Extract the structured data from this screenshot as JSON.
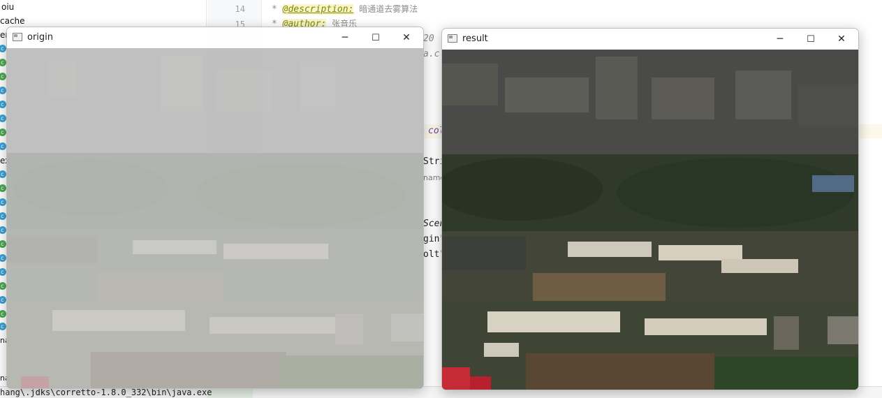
{
  "project_tree": {
    "items": [
      {
        "label": "oiu"
      },
      {
        "label": "cache"
      },
      {
        "label": "en"
      },
      {
        "label": "ex"
      }
    ]
  },
  "editor": {
    "line_numbers": [
      "14",
      "15"
    ],
    "comment_line_1": {
      "tag": "@description:",
      "text": "暗通道去雾算法"
    },
    "comment_line_2": {
      "tag": "@author:",
      "text": "张音乐"
    },
    "fragments": {
      "date_hint": "20",
      "url_hint": "a.c",
      "col_hint": "col",
      "stri": "Stri",
      "name_hint": "name",
      "scen": "Scen",
      "gin": "gin\"",
      "olt": "olt\""
    }
  },
  "console": {
    "text": "hang\\.jdks\\corretto-1.8.0_332\\bin\\java.exe"
  },
  "windows": {
    "origin": {
      "title": "origin"
    },
    "result": {
      "title": "result"
    },
    "controls": {
      "minimize": "─",
      "maximize": "☐",
      "close": "✕"
    }
  },
  "colors": {
    "haze_overlay": "#d8d8d8",
    "roof_red": "#c62a35",
    "field_green": "#3f6a2c",
    "building_white": "#ded8cc"
  }
}
